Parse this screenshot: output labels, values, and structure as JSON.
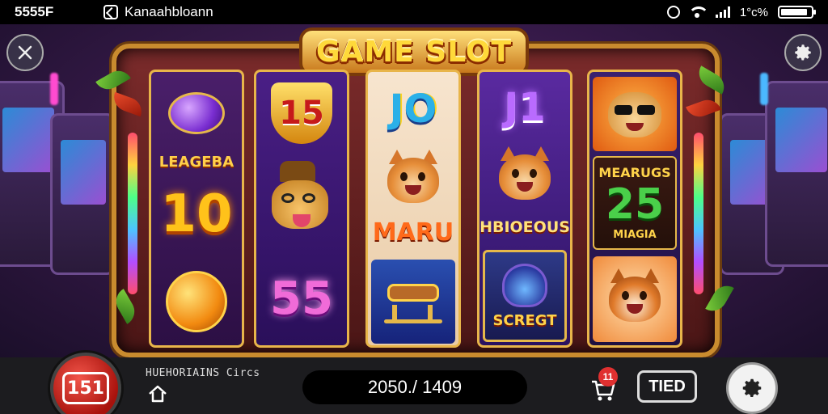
{
  "status_bar": {
    "time": "5555F",
    "app_name": "Kanaahbloann",
    "battery_text": "1°c%",
    "battery_level_percent": 90
  },
  "game": {
    "title": "GAME SLOT",
    "reels": [
      {
        "symbols": [
          {
            "icon": "purple-ball-icon"
          },
          {
            "label": "LEAGEBA"
          },
          {
            "number": "10"
          },
          {
            "icon": "orange-ball-icon"
          }
        ]
      },
      {
        "symbols": [
          {
            "number": "15"
          },
          {
            "icon": "dog-hat-icon"
          },
          {
            "number": "55"
          }
        ]
      },
      {
        "symbols": [
          {
            "number": "JO"
          },
          {
            "icon": "shiba-face-icon"
          },
          {
            "label": "MARU"
          },
          {
            "icon": "sled-icon"
          }
        ]
      },
      {
        "symbols": [
          {
            "number": "J1"
          },
          {
            "icon": "shiba-face-icon"
          },
          {
            "label": "HBIOEOUS"
          },
          {
            "icon": "hooded-creature-icon"
          },
          {
            "label": "SCREGT"
          }
        ]
      },
      {
        "symbols": [
          {
            "icon": "dog-sunglasses-icon"
          },
          {
            "label": "MEARUGS"
          },
          {
            "number": "25"
          },
          {
            "label": "MIAGIA"
          },
          {
            "icon": "fox-face-icon"
          }
        ]
      }
    ]
  },
  "bottom_bar": {
    "label": "HUEHORIAINS  Circs",
    "balance": "2050./ 1409",
    "notification_count": "11",
    "med_button_label": "TIED",
    "spin_button_label": "151"
  },
  "colors": {
    "accent": "#c98b2e",
    "spin_button": "#d0221a",
    "frame": "#7b2b2b"
  }
}
